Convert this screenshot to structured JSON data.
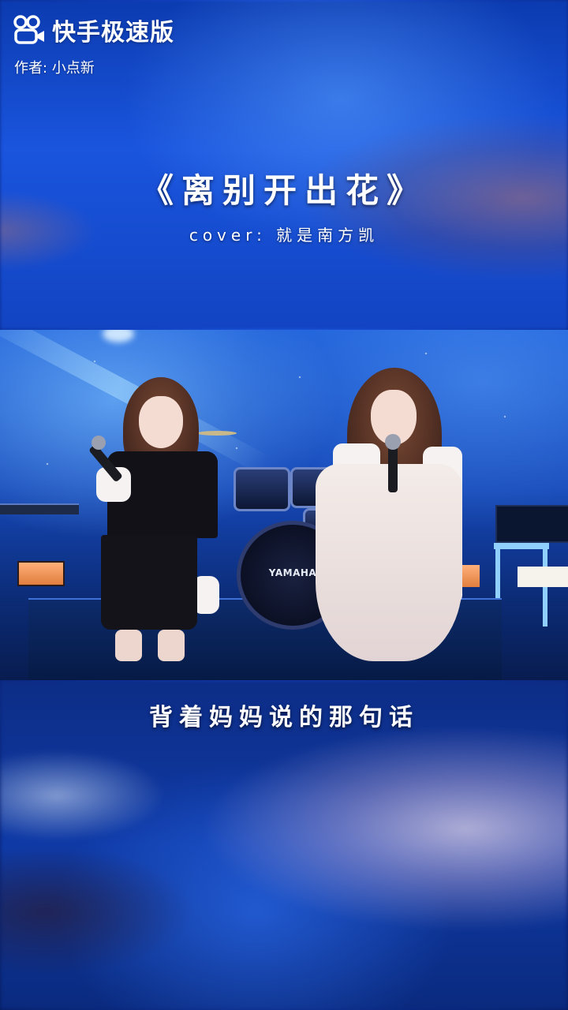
{
  "app": {
    "brand_name": "快手极速版",
    "logo_icon": "kuaishou-logo-icon"
  },
  "video": {
    "author_line": "作者: 小点新",
    "title": "《离别开出花》",
    "cover_line": "cover: 就是南方凯",
    "lyric": "背着妈妈说的那句话",
    "drum_brand": "YAMAHA"
  },
  "colors": {
    "background_blue": "#1543c9",
    "text": "#ffffff"
  }
}
